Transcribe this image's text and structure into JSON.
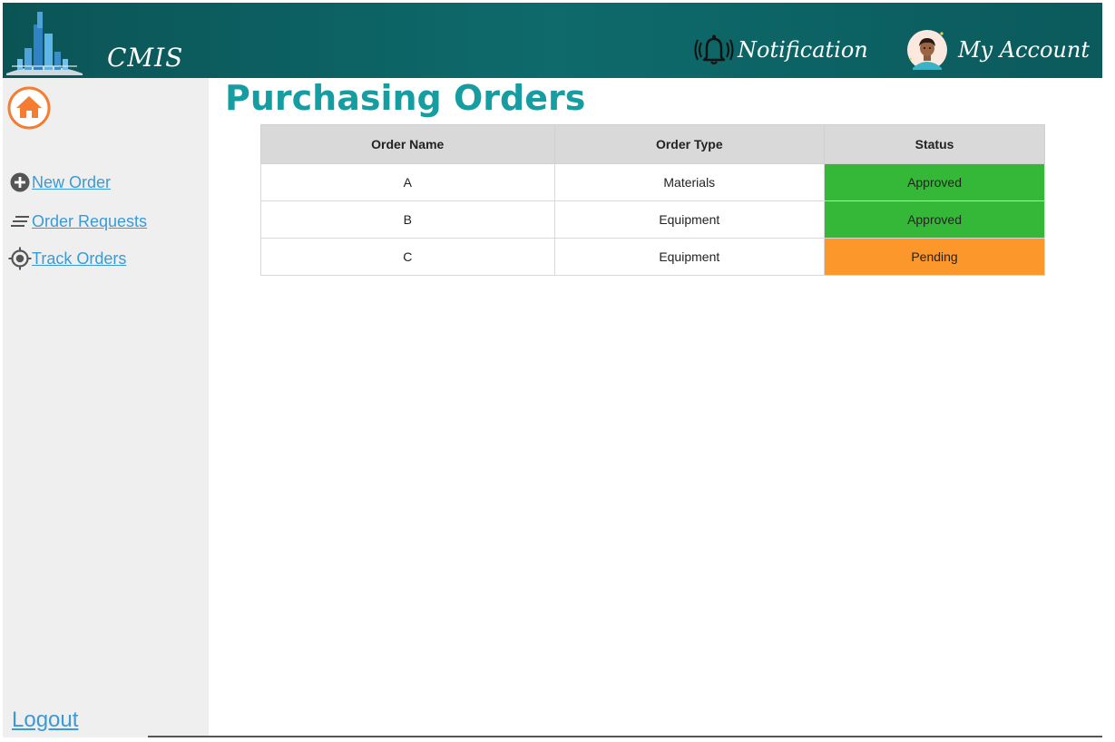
{
  "header": {
    "app_name": "CMIS",
    "notification_label": "Notification",
    "account_label": "My Account"
  },
  "sidebar": {
    "items": [
      {
        "label": "New Order",
        "icon": "plus-circle-icon"
      },
      {
        "label": "Order Requests",
        "icon": "lines-icon"
      },
      {
        "label": "Track Orders",
        "icon": "target-icon"
      }
    ],
    "logout_label": "Logout",
    "home_icon": "home-icon"
  },
  "main": {
    "title": "Purchasing Orders",
    "table": {
      "columns": [
        "Order Name",
        "Order Type",
        "Status"
      ],
      "rows": [
        {
          "name": "A",
          "type": "Materials",
          "status": "Approved"
        },
        {
          "name": "B",
          "type": "Equipment",
          "status": "Approved"
        },
        {
          "name": "C",
          "type": "Equipment",
          "status": "Pending"
        }
      ]
    }
  },
  "colors": {
    "header_bg": "#0e6a6b",
    "title": "#159da2",
    "link": "#3a9ad6",
    "approved": "#35b837",
    "pending": "#fc972b",
    "home_accent": "#f47d32"
  }
}
